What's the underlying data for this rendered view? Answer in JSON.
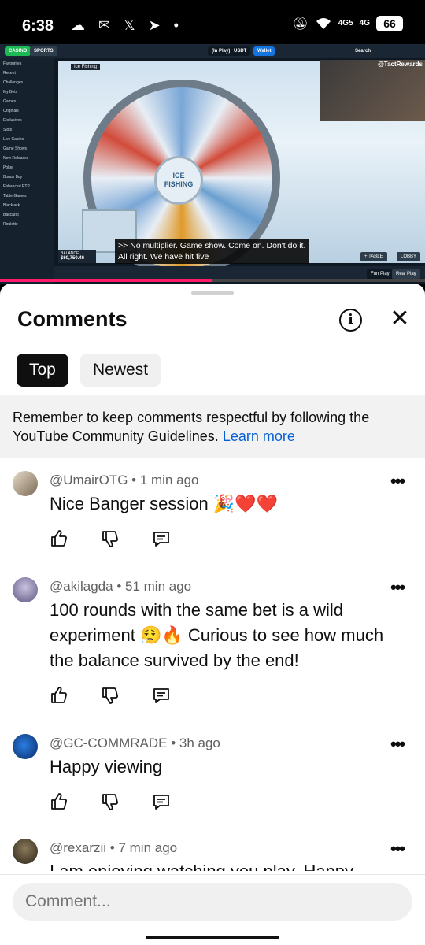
{
  "status_bar": {
    "time": "6:38",
    "notif_icons": "☁ ✉ 𝕏 ➤ •",
    "net1": "4G5",
    "net2": "4G",
    "battery": "66"
  },
  "video": {
    "casino_tab": "CASINO",
    "sports_tab": "SPORTS",
    "in_play": "(In Play)",
    "currency": "USDT",
    "wallet": "Wallet",
    "search": "Search",
    "sidebar_items": [
      "Favourites",
      "Recent",
      "Challenges",
      "My Bets",
      "Games",
      "Originals",
      "Exclusives",
      "Slots",
      "Live Casino",
      "Game Shows",
      "New Releases",
      "Poker",
      "Bonus Buy",
      "Enhanced RTP",
      "Table Games",
      "Blackjack",
      "Baccarat",
      "Roulette"
    ],
    "game_name": "Ice Fishing",
    "wheel_label_1": "ICE",
    "wheel_label_2": "FISHING",
    "watermark": "@TactRewards",
    "balance_label": "BALANCE",
    "balance": "$60,750.46",
    "caption": ">> No multiplier. Game show. Come on. Don't do it. All right. We have hit five",
    "table_btn": "+ TABLE",
    "lobby_btn": "LOBBY",
    "fun_play": "Fun Play",
    "real_play": "Real Play",
    "progress": 0.5
  },
  "sheet": {
    "title": "Comments",
    "info_icon": "i",
    "close_icon": "✕",
    "tabs": [
      "Top",
      "Newest"
    ],
    "notice_text": "Remember to keep comments respectful by following the YouTube Community Guidelines.",
    "notice_link": "Learn more",
    "comments": [
      {
        "author": "@UmairOTG",
        "age": "1 min ago",
        "text": "Nice Banger session 🎉❤️❤️"
      },
      {
        "author": "@akilagda",
        "age": "51 min ago",
        "text": "100 rounds with the same bet is a wild experiment 😮‍💨🔥 Curious to see how much the balance survived by the end!"
      },
      {
        "author": "@GC-COMMRADE",
        "age": "3h ago",
        "text": "Happy viewing"
      },
      {
        "author": "@rexarzii",
        "age": "7 min ago",
        "text": "I am enjoying watching you play. Happy"
      }
    ],
    "more_icon": "•••",
    "comment_placeholder": "Comment..."
  },
  "colors": {
    "accent_blue": "#065fd4",
    "progress_red": "#ff1a6b",
    "casino_green": "#1db954",
    "wallet_blue": "#1475e1"
  }
}
